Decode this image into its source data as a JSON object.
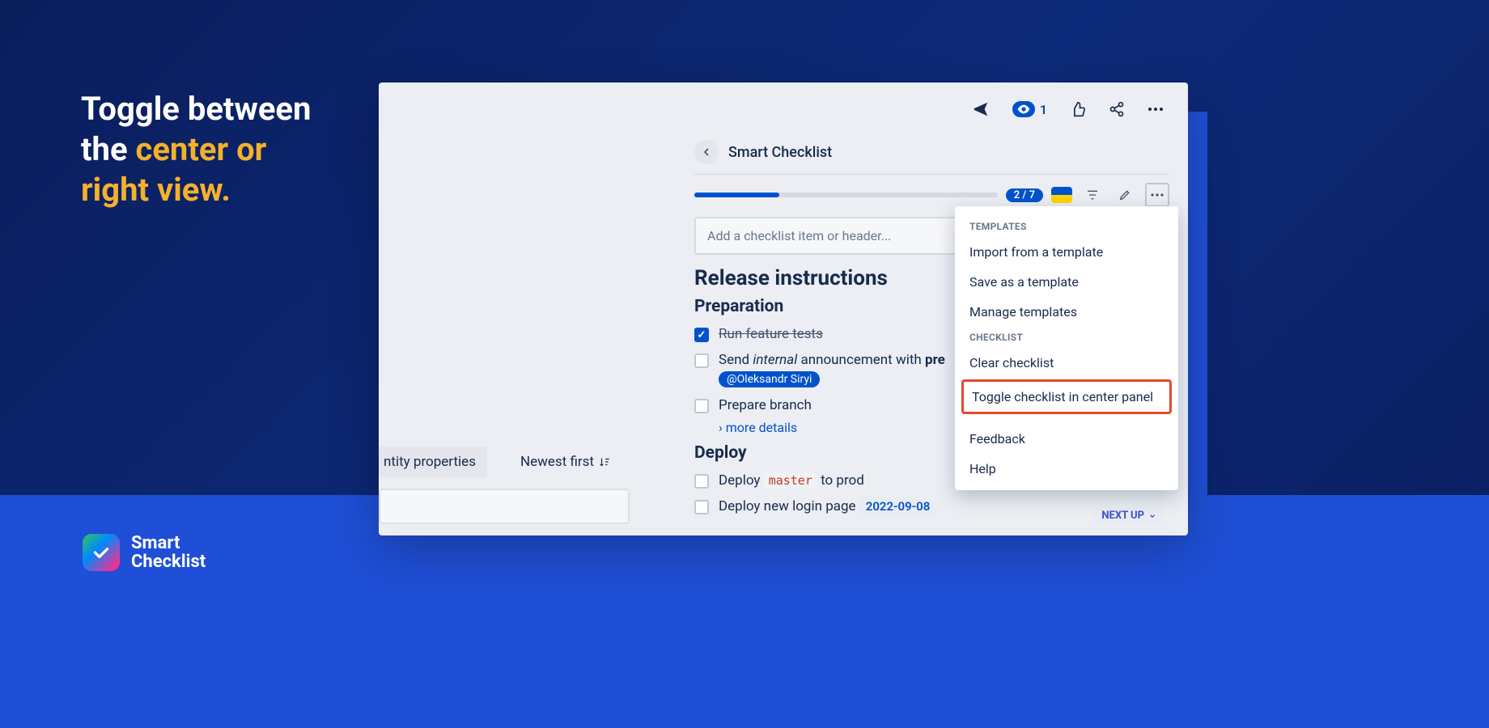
{
  "hero": {
    "line1": "Toggle between",
    "line2_prefix": "the ",
    "line2_accent": "center or",
    "line3_accent": "right view."
  },
  "brand": {
    "name_line1": "Smart",
    "name_line2": "Checklist"
  },
  "topbar": {
    "watch_count": "1"
  },
  "left_partial": {
    "entity_chip": "ntity properties",
    "sort_label": "Newest first"
  },
  "panel": {
    "title": "Smart Checklist",
    "progress_count": "2 / 7",
    "add_placeholder": "Add a checklist item or header...",
    "h1": "Release instructions",
    "sections": {
      "prep": {
        "title": "Preparation",
        "items": {
          "run_tests": "Run feature tests",
          "send_prefix": "Send ",
          "send_italic": "internal",
          "send_mid": " announcement with ",
          "send_bold": "pre",
          "mention": "@Oleksandr Siryi",
          "prepare": "Prepare branch",
          "more": "› more details"
        }
      },
      "deploy": {
        "title": "Deploy",
        "items": {
          "deploy_master_pre": "Deploy ",
          "deploy_master_code": "master",
          "deploy_master_post": " to prod",
          "deploy_login": "Deploy new login page",
          "deploy_date": "2022-09-08"
        }
      }
    },
    "next_up": "NEXT UP"
  },
  "dropdown": {
    "header_templates": "TEMPLATES",
    "import": "Import from a template",
    "save": "Save as a template",
    "manage": "Manage templates",
    "header_checklist": "CHECKLIST",
    "clear": "Clear checklist",
    "toggle": "Toggle checklist in center panel",
    "feedback": "Feedback",
    "help": "Help"
  }
}
